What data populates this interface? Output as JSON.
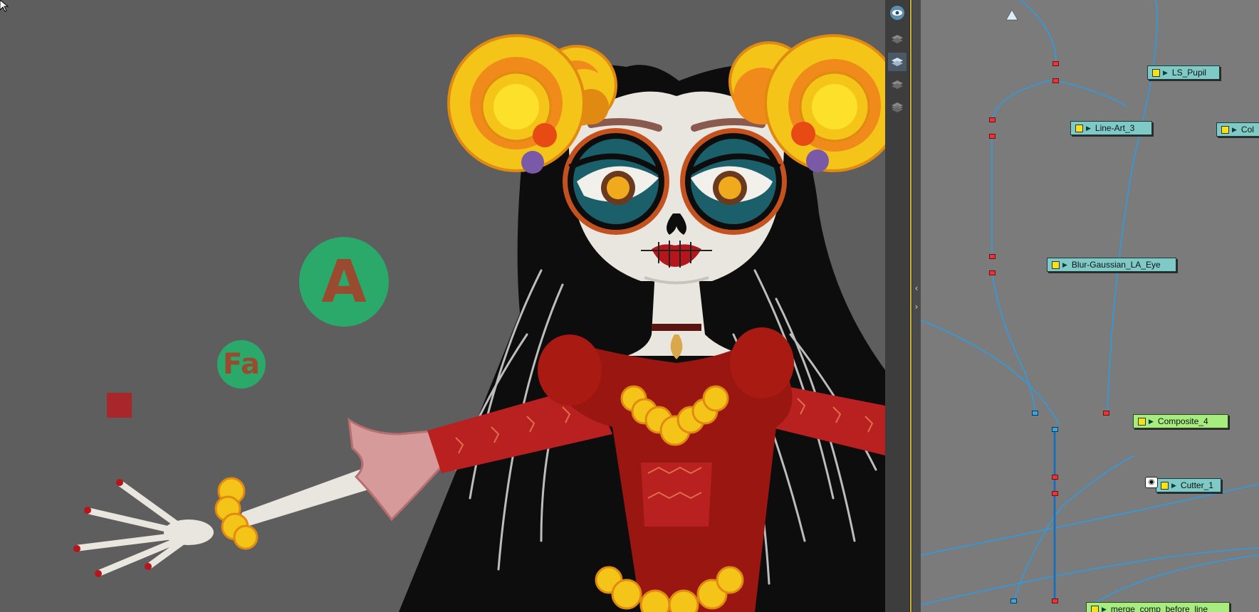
{
  "canvas": {
    "badges": [
      {
        "id": "badge-a",
        "text": "A"
      },
      {
        "id": "badge-fa",
        "text": "Fa"
      }
    ]
  },
  "toolbar": {
    "tools": [
      {
        "name": "eye-icon",
        "active": false
      },
      {
        "name": "layers-icon",
        "active": false
      },
      {
        "name": "layers-light-icon",
        "active": true
      },
      {
        "name": "layers-dark-icon",
        "active": false
      },
      {
        "name": "layers-stack-icon",
        "active": false
      }
    ]
  },
  "node_view": {
    "nodes": [
      {
        "id": "ls-pupil",
        "label": "LS_Pupil"
      },
      {
        "id": "line-art-3",
        "label": "Line-Art_3"
      },
      {
        "id": "col",
        "label": "Col"
      },
      {
        "id": "blur-gaussian",
        "label": "Blur-Gaussian_LA_Eye"
      },
      {
        "id": "composite-4",
        "label": "Composite_4"
      },
      {
        "id": "cutter-1",
        "label": "Cutter_1"
      },
      {
        "id": "merge-comp",
        "label": "merge_comp_before_line"
      }
    ]
  },
  "colors": {
    "viewport_bg": "#5e5e5e",
    "node_view_bg": "#7b7b7b",
    "wire": "#2f9be0",
    "node_teal": "#7fc9c6",
    "node_green": "#a6ec7e",
    "badge_green": "#2aa96b",
    "badge_text": "#9a4a2e"
  }
}
